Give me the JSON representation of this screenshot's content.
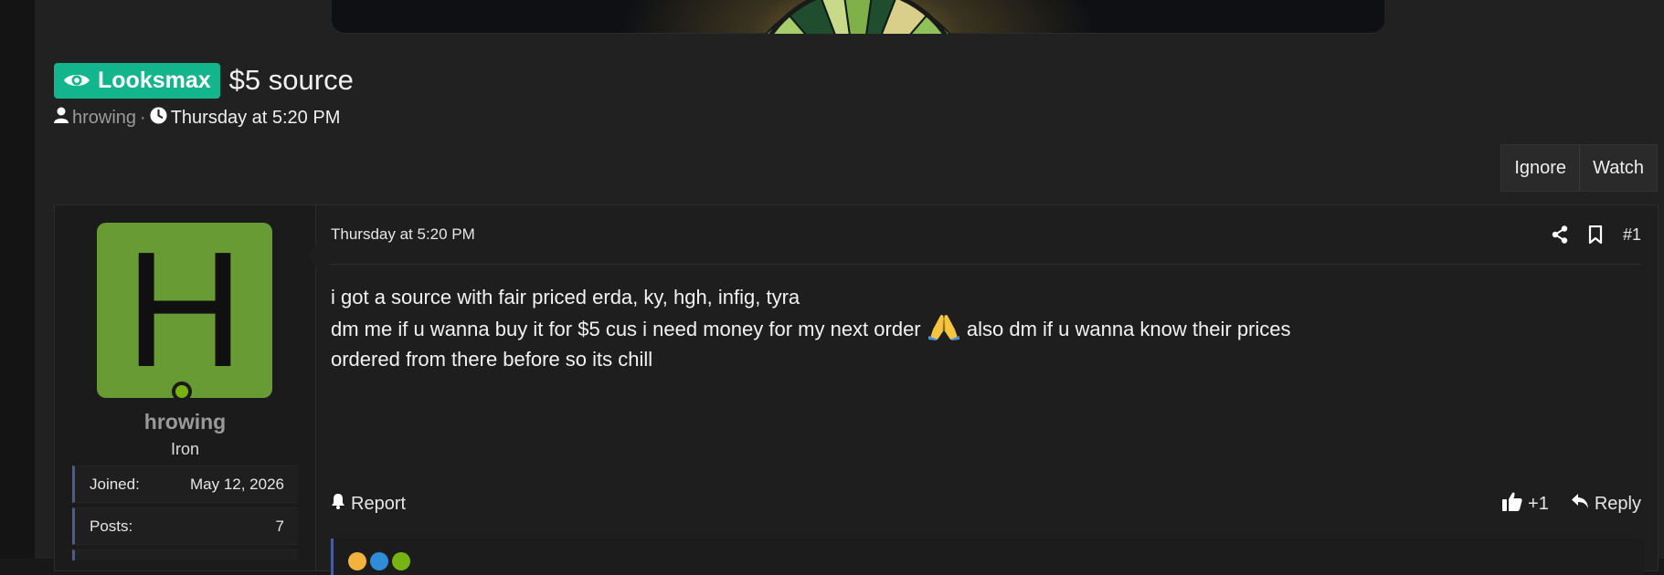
{
  "thread": {
    "prefix_label": "Looksmax",
    "prefix_color": "#12b58c",
    "title": "$5 source",
    "author": "hrowing",
    "separator": "·",
    "date": "Thursday at 5:20 PM"
  },
  "thread_actions": {
    "ignore_label": "Ignore",
    "watch_label": "Watch"
  },
  "post": {
    "date": "Thursday at 5:20 PM",
    "number": "#1",
    "lines": [
      "i got a source with fair priced erda, ky, hgh, infig, tyra",
      "dm me if u wanna buy it for $5 cus i need money for my next order",
      "also dm if u wanna know their prices",
      "ordered from there before so its chill"
    ],
    "report_label": "Report",
    "plus_one_label": "+1",
    "reply_label": "Reply"
  },
  "user": {
    "avatar_letter": "H",
    "avatar_color": "#689b33",
    "username": "hrowing",
    "title": "Iron",
    "stats": [
      {
        "label": "Joined:",
        "value": "May 12, 2026"
      },
      {
        "label": "Posts:",
        "value": "7"
      }
    ]
  },
  "icons": {
    "prefix": "eye-icon",
    "author": "user-icon",
    "date": "clock-icon",
    "share": "share-icon",
    "bookmark": "bookmark-icon",
    "report": "bell-icon",
    "like": "thumbs-up-icon",
    "reply": "reply-icon",
    "emoji": "folded-hands-emoji"
  }
}
